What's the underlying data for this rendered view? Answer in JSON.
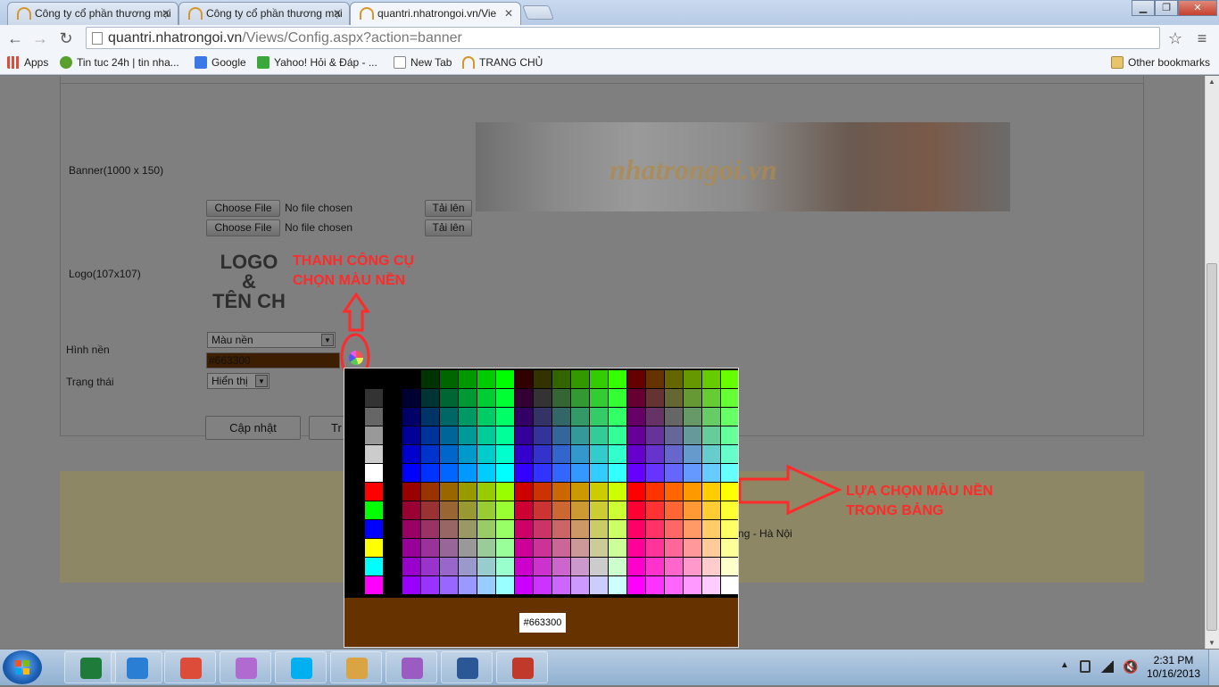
{
  "browser": {
    "tabs": [
      {
        "label": "Công ty cổ phần thương mại"
      },
      {
        "label": "Công ty cổ phần thương mại"
      },
      {
        "label": "quantri.nhatrongoi.vn/Vie"
      }
    ],
    "url_host": "quantri.nhatrongoi.vn",
    "url_path": "/Views/Config.aspx?action=banner",
    "bookmarks": [
      {
        "label": "Apps",
        "icon": "apps-icon",
        "color": "#e04b3a"
      },
      {
        "label": "Tin tuc 24h | tin nha...",
        "icon": "tintuc-icon",
        "color": "#5aa02c"
      },
      {
        "label": "Google",
        "icon": "google-icon",
        "color": "#3b78e7"
      },
      {
        "label": "Yahoo! Hỏi & Đáp - ...",
        "icon": "yahoo-icon",
        "color": "#3aa83a"
      },
      {
        "label": "New Tab",
        "icon": "page-icon",
        "color": "#ffffff"
      },
      {
        "label": "TRANG CHỦ",
        "icon": "trangchu-icon",
        "color": "#d8962a"
      }
    ],
    "other_bookmarks": "Other bookmarks"
  },
  "form": {
    "banner_label": "Banner(1000 x 150)",
    "choose_file": "Choose File",
    "no_file": "No file chosen",
    "upload": "Tải lên",
    "logo_label": "Logo(107x107)",
    "logo_lines": [
      "LOGO",
      "&",
      "TÊN CH"
    ],
    "banner_watermark": "nhatrongoi.vn",
    "bg_label": "Hình nền",
    "bg_select": "Màu nền",
    "bg_color_value": "#663300",
    "status_label": "Trạng thái",
    "status_select": "Hiển thị",
    "update_button": "Cập nhật",
    "second_button": "Tr"
  },
  "footer": {
    "text": "ưng - Hà Nội"
  },
  "annotations": {
    "toolbar_note": [
      "THANH CÔNG CỤ",
      "CHỌN MÀU NỀN"
    ],
    "table_note": [
      "LỰA CHỌN MÀU NỀN",
      "TRONG BẢNG"
    ],
    "color": "#ff2a2a"
  },
  "color_picker": {
    "selected": "#663300",
    "preview_label": "#663300"
  },
  "taskbar": {
    "apps": [
      {
        "name": "excel-icon",
        "color": "#1e7b3a"
      },
      {
        "name": "ie-icon",
        "color": "#2a7fd4"
      },
      {
        "name": "chrome-icon",
        "color": "#dd4b39"
      },
      {
        "name": "messenger-icon",
        "color": "#b06ad0"
      },
      {
        "name": "skype-icon",
        "color": "#00aff0"
      },
      {
        "name": "paint-icon",
        "color": "#d9a441"
      },
      {
        "name": "yahoo-messenger-icon",
        "color": "#9a5cc0"
      },
      {
        "name": "word-icon",
        "color": "#2b5797"
      },
      {
        "name": "snipping-tool-icon",
        "color": "#c0392b"
      }
    ],
    "time": "2:31 PM",
    "date": "10/16/2013"
  }
}
